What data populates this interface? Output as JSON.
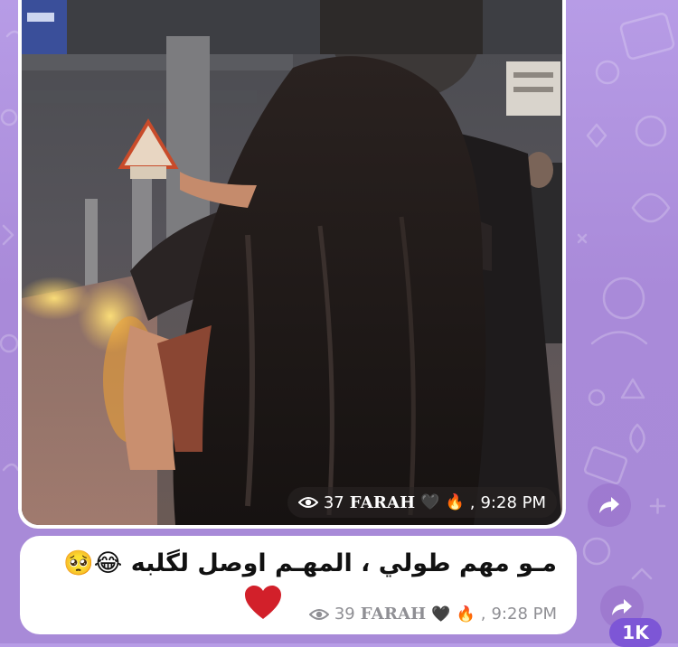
{
  "colors": {
    "chat_background": "#b79ce6",
    "bubble": "#ffffff",
    "meta_pill": "rgba(40,35,35,0.62)",
    "share_button": "#9a6ec8",
    "badge": "#7d56d6",
    "heart": "#d2202a"
  },
  "photo_message": {
    "image_description_icon": "photo-icon",
    "views_icon": "eye-icon",
    "views": "37",
    "signature": "FARAH",
    "signature_emoji": "🖤",
    "fire_emoji": "🔥",
    "separator": ",",
    "time": "9:28 PM"
  },
  "text_message": {
    "text": "مـو مهم طولي ، المهـم اوصل لگلبه",
    "emojis": "😂🥺",
    "heart_icon": "red-heart-icon",
    "views_icon": "eye-icon",
    "views": "39",
    "signature": "FARAH",
    "signature_emoji": "🖤",
    "fire_emoji": "🔥",
    "separator": ",",
    "time": "9:28 PM"
  },
  "share_buttons": {
    "icon": "share-arrow-icon"
  },
  "reaction_badge": {
    "label": "1K"
  }
}
